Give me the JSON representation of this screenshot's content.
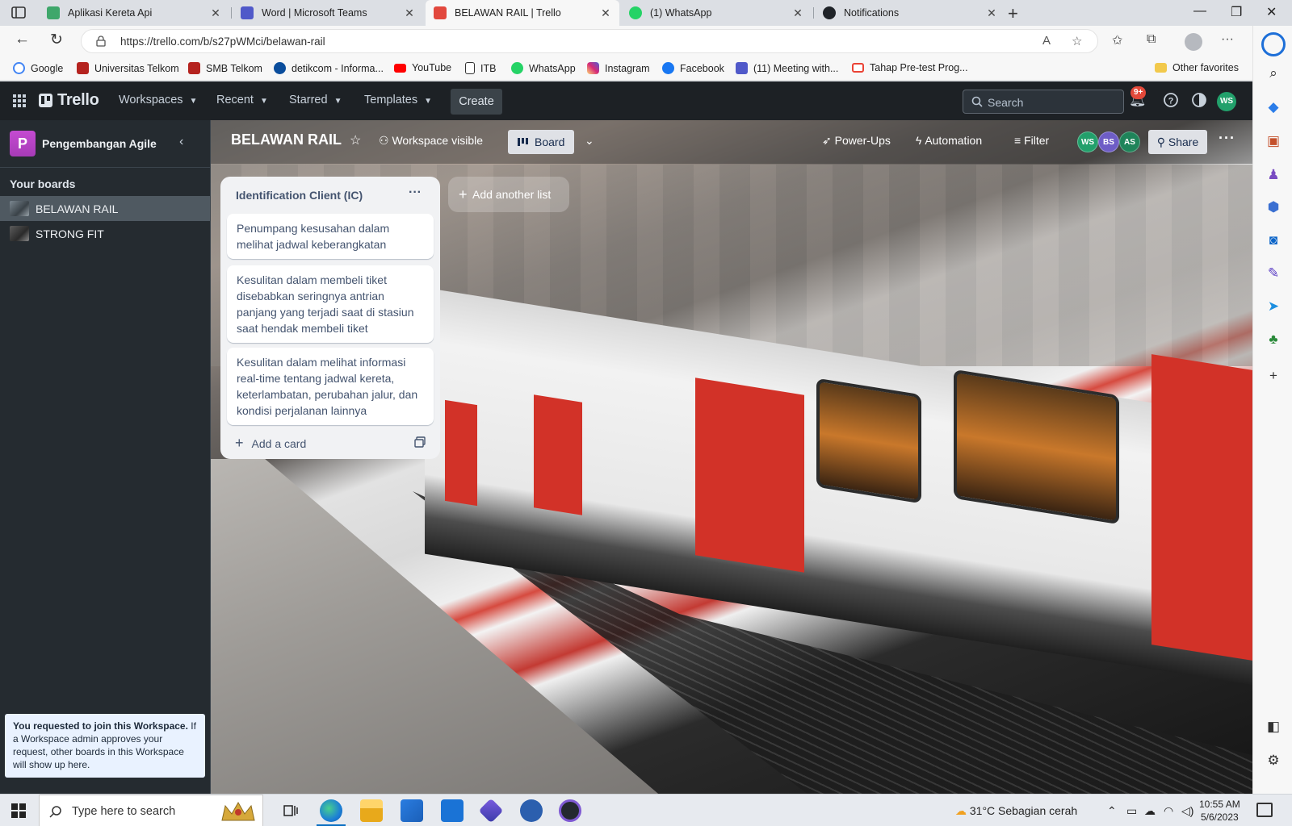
{
  "browser": {
    "tabs": [
      {
        "label": "Aplikasi Kereta Api",
        "active": false,
        "color": "#3fa76b"
      },
      {
        "label": "Word | Microsoft Teams",
        "active": false,
        "color": "#5059c9"
      },
      {
        "label": "BELAWAN RAIL | Trello",
        "active": true,
        "color": "#e2483d"
      },
      {
        "label": "(1) WhatsApp",
        "active": false,
        "color": "#25d366"
      },
      {
        "label": "Notifications",
        "active": false,
        "color": "#1f2328"
      }
    ],
    "close_glyph": "✕",
    "url": "https://trello.com/b/s27pWMci/belawan-rail",
    "favorites": [
      {
        "label": "Google",
        "color": "#4285f4"
      },
      {
        "label": "Universitas Telkom",
        "color": "#b5231f"
      },
      {
        "label": "SMB Telkom",
        "color": "#b5231f"
      },
      {
        "label": "detikcom - Informa...",
        "color": "#0a4d9c"
      },
      {
        "label": "YouTube",
        "color": "#ff0000"
      },
      {
        "label": "ITB",
        "color": "#ffffff"
      },
      {
        "label": "WhatsApp",
        "color": "#25d366"
      },
      {
        "label": "Instagram",
        "color": "#d62976"
      },
      {
        "label": "Facebook",
        "color": "#1877f2"
      },
      {
        "label": "(11) Meeting with...",
        "color": "#5059c9"
      },
      {
        "label": "Tahap Pre-test Prog...",
        "color": "#ea4335"
      }
    ],
    "other_favorites": "Other favorites"
  },
  "trello": {
    "logo": "Trello",
    "nav": {
      "workspaces": "Workspaces",
      "recent": "Recent",
      "starred": "Starred",
      "templates": "Templates",
      "create": "Create"
    },
    "search_placeholder": "Search",
    "notification_badge": "9+",
    "user_initials": "WS",
    "workspace": {
      "initial": "P",
      "name": "Pengembangan Agile",
      "your_boards_label": "Your boards",
      "boards": [
        {
          "name": "BELAWAN RAIL",
          "active": true
        },
        {
          "name": "STRONG FIT",
          "active": false
        }
      ],
      "join_notice_bold": "You requested to join this Workspace.",
      "join_notice_rest": " If a Workspace admin approves your request, other boards in this Workspace will show up here."
    },
    "board": {
      "title": "BELAWAN RAIL",
      "visibility": "Workspace visible",
      "view": "Board",
      "power_ups": "Power-Ups",
      "automation": "Automation",
      "filter": "Filter",
      "members": [
        {
          "initials": "WS",
          "color": "#22a06b"
        },
        {
          "initials": "BS",
          "color": "#6e5dc6"
        },
        {
          "initials": "AS",
          "color": "#1f845a"
        }
      ],
      "share": "Share",
      "lists": [
        {
          "title": "Identification Client (IC)",
          "cards": [
            "Penumpang kesusahan dalam melihat jadwal keberangkatan",
            "Kesulitan dalam membeli tiket disebabkan seringnya antrian panjang yang terjadi saat di stasiun saat hendak membeli tiket",
            "Kesulitan dalam melihat informasi real-time tentang jadwal kereta, keterlambatan, perubahan jalur, dan kondisi perjalanan lainnya"
          ],
          "add_card": "Add a card"
        }
      ],
      "add_list": "Add another list"
    }
  },
  "taskbar": {
    "search_placeholder": "Type here to search",
    "weather": "31°C  Sebagian cerah",
    "time": "10:55 AM",
    "date": "5/6/2023"
  }
}
